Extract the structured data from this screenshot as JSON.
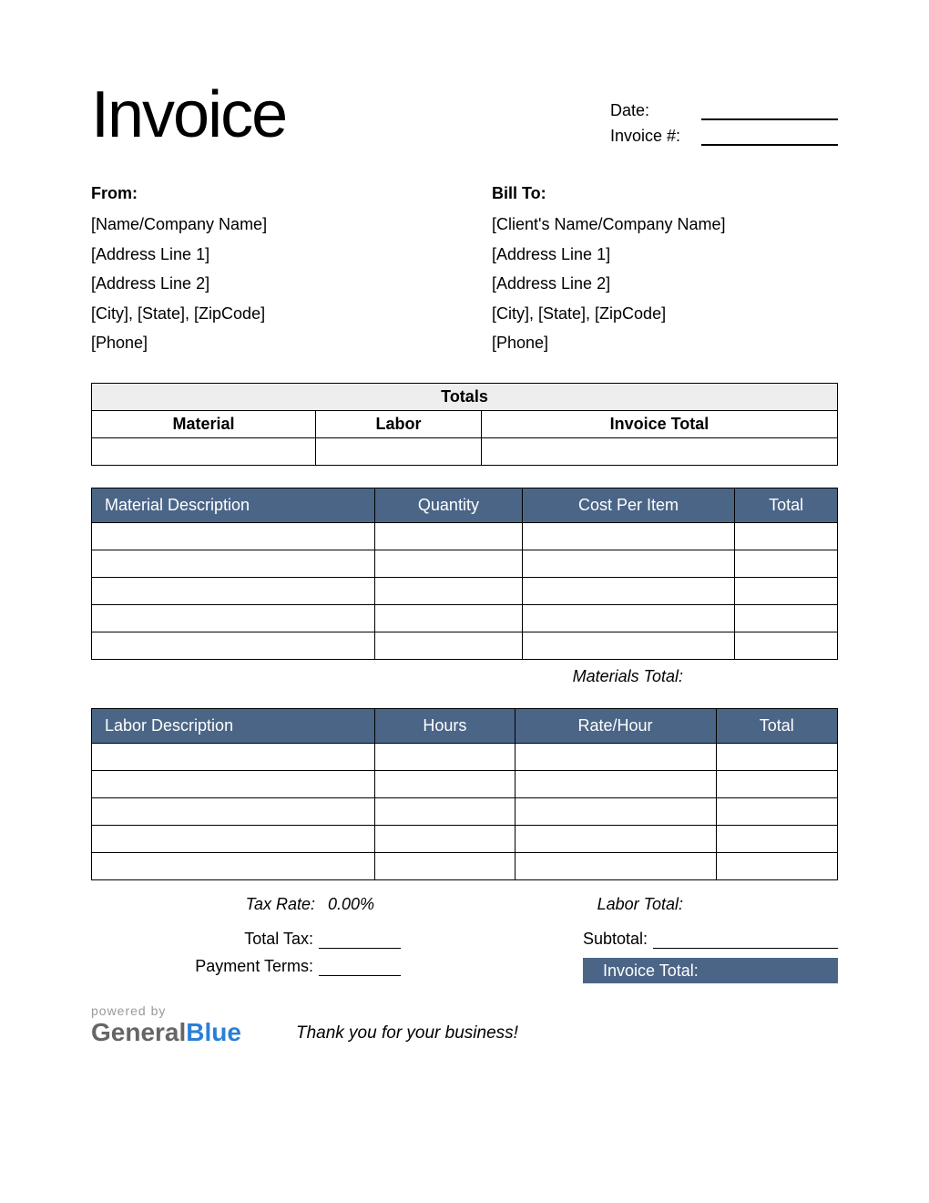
{
  "title": "Invoice",
  "meta": {
    "date_label": "Date:",
    "date_value": "",
    "invoice_num_label": "Invoice #:",
    "invoice_num_value": ""
  },
  "from": {
    "heading": "From:",
    "name": "[Name/Company Name]",
    "addr1": "[Address Line 1]",
    "addr2": "[Address Line 2]",
    "city": "[City], [State], [ZipCode]",
    "phone": "[Phone]"
  },
  "bill_to": {
    "heading": "Bill To:",
    "name": "[Client's Name/Company Name]",
    "addr1": "[Address Line 1]",
    "addr2": "[Address Line 2]",
    "city": "[City], [State], [ZipCode]",
    "phone": "[Phone]"
  },
  "totals_table": {
    "header": "Totals",
    "cols": {
      "material": "Material",
      "labor": "Labor",
      "invoice_total": "Invoice Total"
    },
    "values": {
      "material": "",
      "labor": "",
      "invoice_total": ""
    }
  },
  "materials": {
    "cols": {
      "desc": "Material Description",
      "qty": "Quantity",
      "cost": "Cost Per Item",
      "total": "Total"
    },
    "rows": [
      {
        "desc": "",
        "qty": "",
        "cost": "",
        "total": ""
      },
      {
        "desc": "",
        "qty": "",
        "cost": "",
        "total": ""
      },
      {
        "desc": "",
        "qty": "",
        "cost": "",
        "total": ""
      },
      {
        "desc": "",
        "qty": "",
        "cost": "",
        "total": ""
      },
      {
        "desc": "",
        "qty": "",
        "cost": "",
        "total": ""
      }
    ],
    "subtotal_label": "Materials Total:"
  },
  "labor": {
    "cols": {
      "desc": "Labor Description",
      "hours": "Hours",
      "rate": "Rate/Hour",
      "total": "Total"
    },
    "rows": [
      {
        "desc": "",
        "hours": "",
        "rate": "",
        "total": ""
      },
      {
        "desc": "",
        "hours": "",
        "rate": "",
        "total": ""
      },
      {
        "desc": "",
        "hours": "",
        "rate": "",
        "total": ""
      },
      {
        "desc": "",
        "hours": "",
        "rate": "",
        "total": ""
      },
      {
        "desc": "",
        "hours": "",
        "rate": "",
        "total": ""
      }
    ],
    "subtotal_label": "Labor Total:"
  },
  "tax": {
    "rate_label": "Tax Rate:",
    "rate_value": "0.00%",
    "total_tax_label": "Total Tax:",
    "total_tax_value": "",
    "payment_terms_label": "Payment Terms:",
    "payment_terms_value": ""
  },
  "summary": {
    "subtotal_label": "Subtotal:",
    "subtotal_value": "",
    "invoice_total_label": "Invoice Total:",
    "invoice_total_value": ""
  },
  "footer": {
    "powered_by": "powered by",
    "brand_general": "General",
    "brand_blue": "Blue",
    "thanks": "Thank you for your business!"
  }
}
